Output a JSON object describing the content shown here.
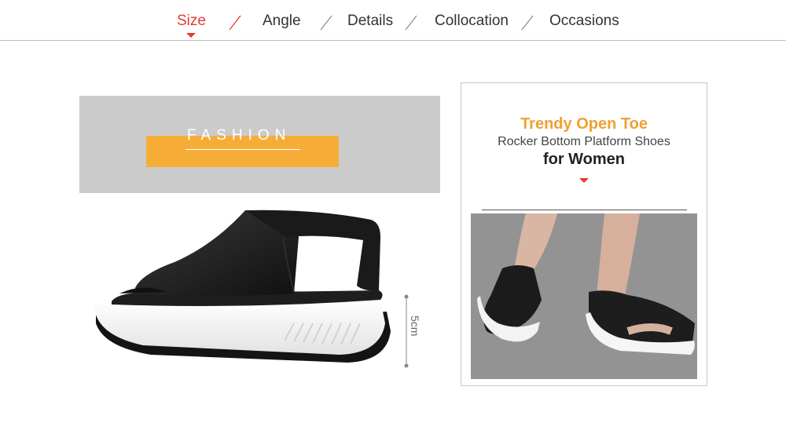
{
  "tabs": [
    {
      "label": "Size",
      "active": true
    },
    {
      "label": "Angle",
      "active": false
    },
    {
      "label": "Details",
      "active": false
    },
    {
      "label": "Collocation",
      "active": false
    },
    {
      "label": "Occasions",
      "active": false
    }
  ],
  "banner": {
    "text": "FASHION"
  },
  "measure": {
    "label": "5cm"
  },
  "card": {
    "title_line1": "Trendy Open Toe",
    "title_line2": "Rocker Bottom Platform Shoes",
    "title_line3": "for Women"
  },
  "colors": {
    "accent": "#e53b2c",
    "orange": "#f5ad38",
    "banner_bg": "#cbcbcb"
  }
}
